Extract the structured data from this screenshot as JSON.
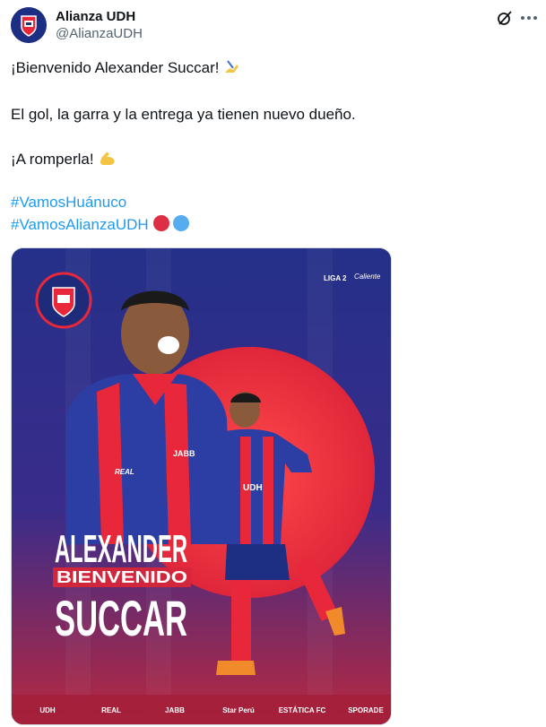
{
  "account": {
    "display_name": "Alianza UDH",
    "handle": "@AlianzaUDH"
  },
  "icons": {
    "grok": "grok-icon",
    "more": "more-options-icon"
  },
  "tweet": {
    "line1": "¡Bienvenido Alexander Succar!",
    "line1_emoji": "writing-hand-emoji",
    "line2": "El gol, la garra y la entrega ya tienen nuevo dueño.",
    "line3": "¡A romperla!",
    "line3_emoji": "flexed-biceps-emoji",
    "hashtag1": "#VamosHuánuco",
    "hashtag2": "#VamosAlianzaUDH",
    "hashtag2_emojis": [
      "red-circle-emoji",
      "blue-circle-emoji"
    ]
  },
  "poster": {
    "league": "LIGA 2",
    "league_partner": "Caliente",
    "name_first": "ALEXANDER",
    "welcome": "BIENVENIDO",
    "name_last": "SUCCAR",
    "jersey_sponsor": "JABB",
    "jersey_brand": "REAL",
    "udh_text": "UDH",
    "sponsors": [
      "UDH",
      "REAL",
      "JABB",
      "Star Perú",
      "ESTÁTICA FC",
      "SPORADE"
    ],
    "colors": {
      "red": "#e8283a",
      "blue": "#2b3894",
      "dark": "#1b1f5e"
    }
  },
  "colors": {
    "text": "#0f1419",
    "secondary": "#536471",
    "link": "#1d9bf0"
  }
}
